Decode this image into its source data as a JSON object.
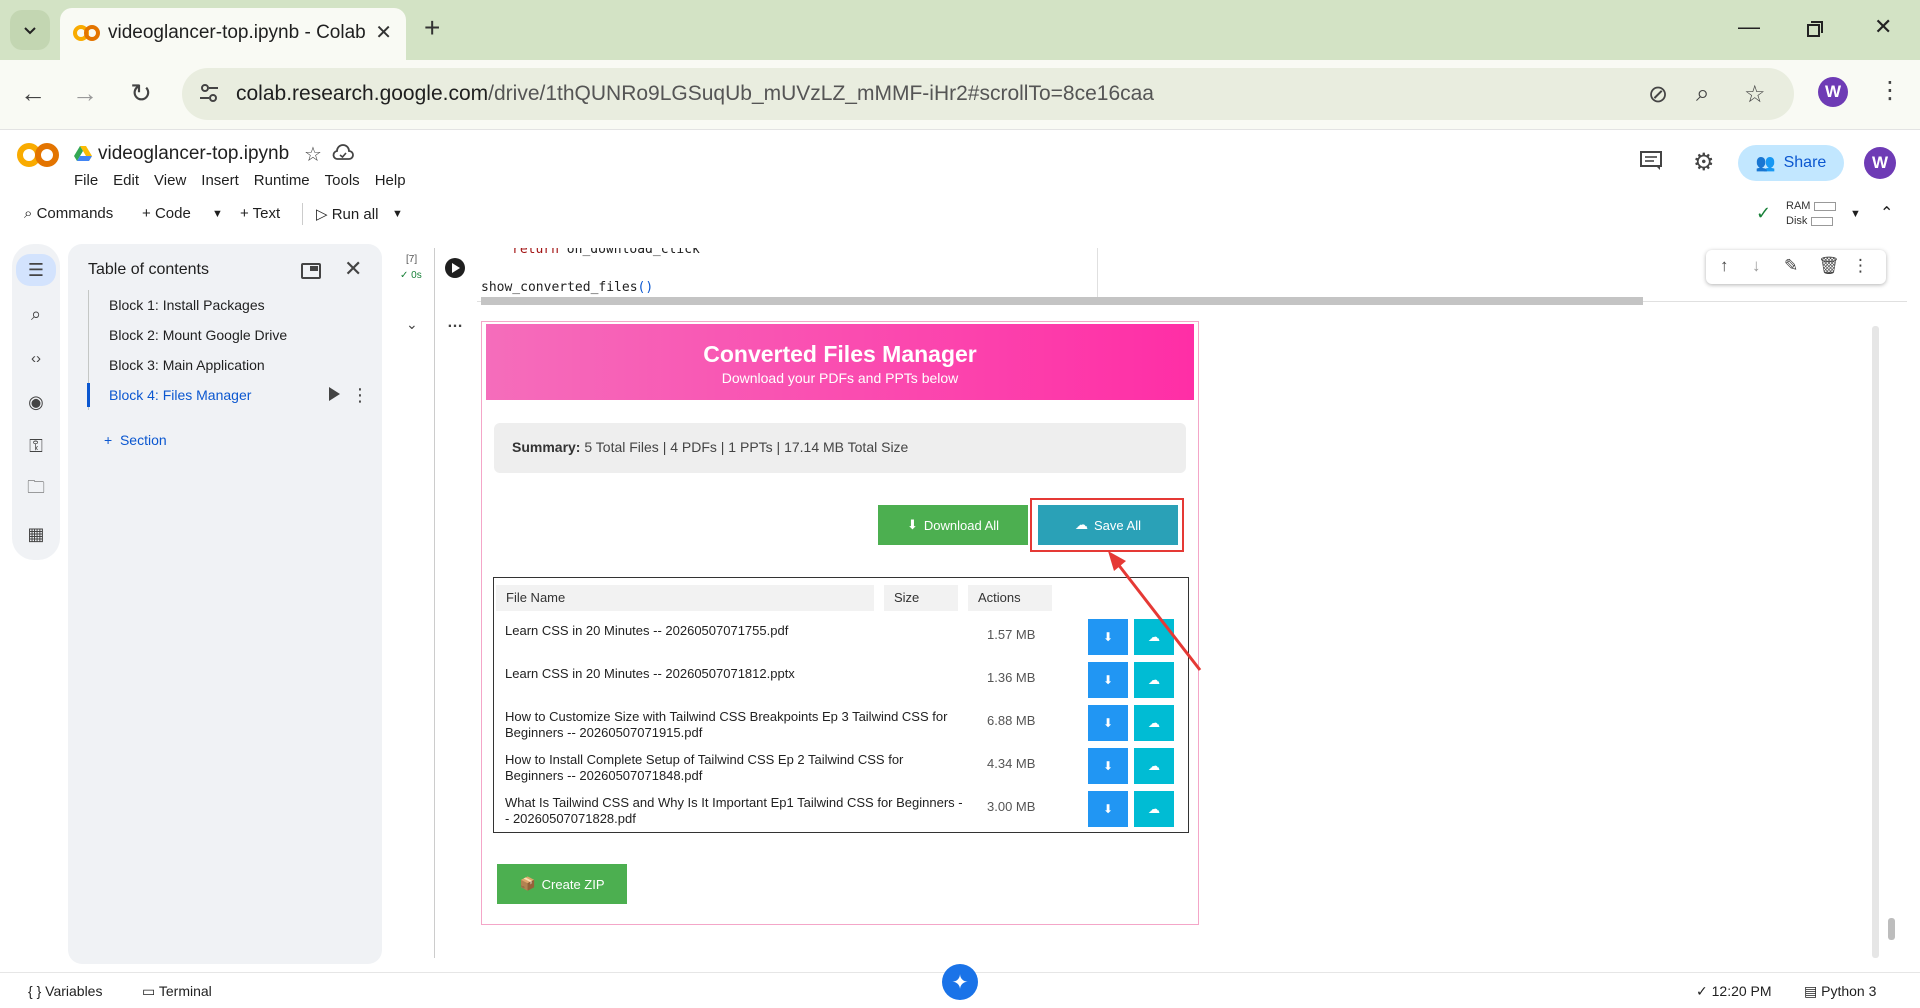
{
  "browser": {
    "tab_title": "videoglancer-top.ipynb - Colab",
    "url_host": "colab.research.google.com",
    "url_path": "/drive/1thQUNRo9LGSuqUb_mUVzLZ_mMMF-iHr2#scrollTo=8ce16caa",
    "avatar_letter": "W"
  },
  "colab": {
    "notebook_title": "videoglancer-top.ipynb",
    "menu": [
      "File",
      "Edit",
      "View",
      "Insert",
      "Runtime",
      "Tools",
      "Help"
    ],
    "share_label": "Share",
    "avatar_letter": "W"
  },
  "toolbar": {
    "commands": "Commands",
    "code": "Code",
    "text": "Text",
    "run_all": "Run all",
    "ram_label": "RAM",
    "disk_label": "Disk"
  },
  "toc": {
    "title": "Table of contents",
    "items": [
      "Block 1: Install Packages",
      "Block 2: Mount Google Drive",
      "Block 3: Main Application",
      "Block 4: Files Manager"
    ],
    "add_section": "Section"
  },
  "cell": {
    "exec_count": "[7]",
    "exec_time": "0s",
    "code_line1_kw": "return",
    "code_line1_rest": " on_download_click",
    "code_line2_fn": "show_converted_files",
    "code_line2_parens": "()"
  },
  "widget": {
    "title": "Converted Files Manager",
    "subtitle": "Download your PDFs and PPTs below",
    "summary_label": "Summary:",
    "summary_text": " 5 Total Files | 4 PDFs | 1 PPTs | 17.14 MB Total Size",
    "download_all": "Download All",
    "save_all": "Save All",
    "create_zip": "Create ZIP",
    "columns": [
      "File Name",
      "Size",
      "Actions"
    ],
    "files": [
      {
        "name": "Learn CSS in 20 Minutes -- 20260507071755.pdf",
        "size": "1.57 MB"
      },
      {
        "name": "Learn CSS in 20 Minutes -- 20260507071812.pptx",
        "size": "1.36 MB"
      },
      {
        "name": "How to Customize Size with Tailwind CSS Breakpoints Ep 3 Tailwind CSS for Beginners -- 20260507071915.pdf",
        "size": "6.88 MB"
      },
      {
        "name": "How to Install Complete Setup of Tailwind CSS Ep 2 Tailwind CSS for Beginners -- 20260507071848.pdf",
        "size": "4.34 MB"
      },
      {
        "name": "What Is Tailwind CSS and Why Is It Important Ep1 Tailwind CSS for Beginners -- 20260507071828.pdf",
        "size": "3.00 MB"
      }
    ]
  },
  "status": {
    "variables": "Variables",
    "terminal": "Terminal",
    "time": "12:20 PM",
    "runtime": "Python 3"
  },
  "colors": {
    "header_gradient_start": "#f56dbb",
    "header_gradient_end": "#ff2ea6",
    "green_button": "#4caf50",
    "save_button": "#2aa1b7",
    "download_icon_button": "#2196f3",
    "save_icon_button": "#00bcd4",
    "annotation_red": "#e53935"
  }
}
